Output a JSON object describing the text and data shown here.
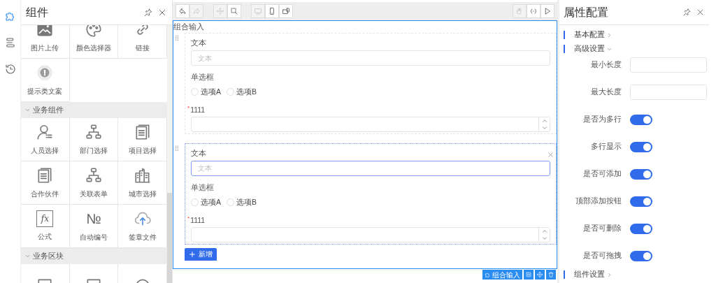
{
  "rail": [
    {
      "selected": true
    },
    {
      "selected": false
    },
    {
      "selected": false
    }
  ],
  "components_panel": {
    "title": "组件",
    "sections": [
      {
        "items": [
          {
            "label": "图片上传"
          },
          {
            "label": "颜色选择器"
          },
          {
            "label": "链接"
          },
          {
            "label": "提示类文案"
          }
        ]
      },
      {
        "title": "业务组件",
        "expanded": true,
        "items": [
          {
            "label": "人员选择"
          },
          {
            "label": "部门选择"
          },
          {
            "label": "项目选择"
          },
          {
            "label": "合作伙伴"
          },
          {
            "label": "关联表单"
          },
          {
            "label": "城市选择"
          },
          {
            "label": "公式",
            "glyph": "fx"
          },
          {
            "label": "自动编号",
            "glyph": "№"
          },
          {
            "label": "签章文件"
          }
        ]
      },
      {
        "title": "业务区块",
        "expanded": true
      }
    ]
  },
  "toolbar": {
    "left_groups": [
      [
        {
          "disabled": false
        },
        {
          "disabled": true
        }
      ],
      [
        {
          "disabled": true
        },
        {
          "disabled": false
        }
      ],
      [
        {
          "disabled": true
        },
        {
          "disabled": false
        },
        {
          "disabled": false
        }
      ]
    ],
    "right_group": [
      {
        "disabled": true
      },
      {
        "disabled": false
      },
      {
        "disabled": false
      }
    ]
  },
  "form": {
    "title": "组合输入",
    "groups": [
      {
        "selected": false,
        "fields": [
          {
            "kind": "text",
            "label": "文本",
            "placeholder": "文本"
          },
          {
            "kind": "radio",
            "label": "单选框",
            "options": [
              {
                "label": "选项A",
                "selected": false
              },
              {
                "label": "选项B",
                "selected": false
              }
            ]
          },
          {
            "kind": "number",
            "label": "1111",
            "required_mark": "*"
          }
        ]
      },
      {
        "selected": true,
        "fields": [
          {
            "kind": "text",
            "label": "文本",
            "placeholder": "文本"
          },
          {
            "kind": "radio",
            "label": "单选框",
            "options": [
              {
                "label": "选项A",
                "selected": false
              },
              {
                "label": "选项B",
                "selected": false
              }
            ]
          },
          {
            "kind": "number",
            "label": "1111",
            "required_mark": "*"
          }
        ]
      }
    ],
    "add_button": "新增",
    "tag": "组合输入"
  },
  "properties": {
    "title": "属性配置",
    "sections": [
      {
        "title": "基本配置",
        "expanded": false
      },
      {
        "title": "高级设置",
        "expanded": true,
        "rows": [
          {
            "kind": "input",
            "label": "最小长度"
          },
          {
            "kind": "input",
            "label": "最大长度"
          },
          {
            "kind": "switch",
            "label": "是否为多行",
            "on": true
          },
          {
            "kind": "switch",
            "label": "多行显示",
            "on": true
          },
          {
            "kind": "switch",
            "label": "是否可添加",
            "on": true
          },
          {
            "kind": "switch",
            "label": "顶部添加按钮",
            "on": true
          },
          {
            "kind": "switch",
            "label": "是否可删除",
            "on": true
          },
          {
            "kind": "switch",
            "label": "是否可拖拽",
            "on": true
          }
        ]
      },
      {
        "title": "组件设置",
        "expanded": false
      }
    ]
  }
}
